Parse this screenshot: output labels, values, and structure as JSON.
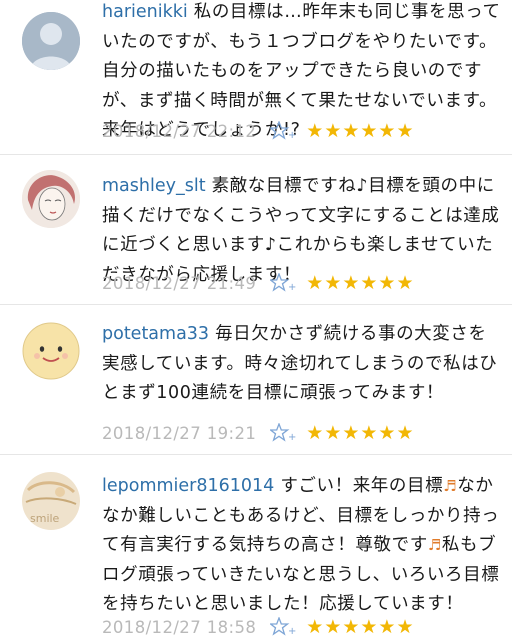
{
  "comments": [
    {
      "username": "harienikki",
      "text": "私の目標は…昨年末も同じ事を思っていたのですが、もう１つブログをやりたいです。自分の描いたものをアップできたら良いのですが、まず描く時間が無くて果たせないでいます。来年はどうでしょうか!?",
      "date": "2018/12/27 22:12",
      "stars": "★★★★★★",
      "avatar": "silhouette-avatar"
    },
    {
      "username": "mashley_slt",
      "text": "素敵な目標ですね♪目標を頭の中に描くだけでなくこうやって文字にすることは達成に近づくと思います♪これからも楽しませていただきながら応援します！",
      "date": "2018/12/27 21:49",
      "stars": "★★★★★★",
      "avatar": "sketch-face-avatar"
    },
    {
      "username": "potetama33",
      "text": "毎日欠かさず続ける事の大変さを実感しています。時々途切れてしまうので私はひとまず100連続を目標に頑張ってみます！",
      "date": "2018/12/27 19:21",
      "stars": "★★★★★★",
      "avatar": "round-face-avatar"
    },
    {
      "username": "lepommier8161014",
      "text_parts": [
        "すごい！来年の目標",
        "なかなか難しいこともあるけど、目標をしっかり持って有言実行する気持ちの高さ！尊敬です",
        "私もブログ頑張っていきたいなと思うし、いろいろ目標を持ちたいと思いました！応援しています！"
      ],
      "note_icon": "♬",
      "date": "2018/12/27 18:58",
      "stars": "★★★★★★",
      "avatar": "drawing-avatar"
    }
  ],
  "colors": {
    "username": "#2e6fa8",
    "date": "#b9b9b9",
    "star": "#f2b705",
    "star_add": "#7fa6d6"
  },
  "icons": {
    "add_star": "add-star-icon"
  }
}
